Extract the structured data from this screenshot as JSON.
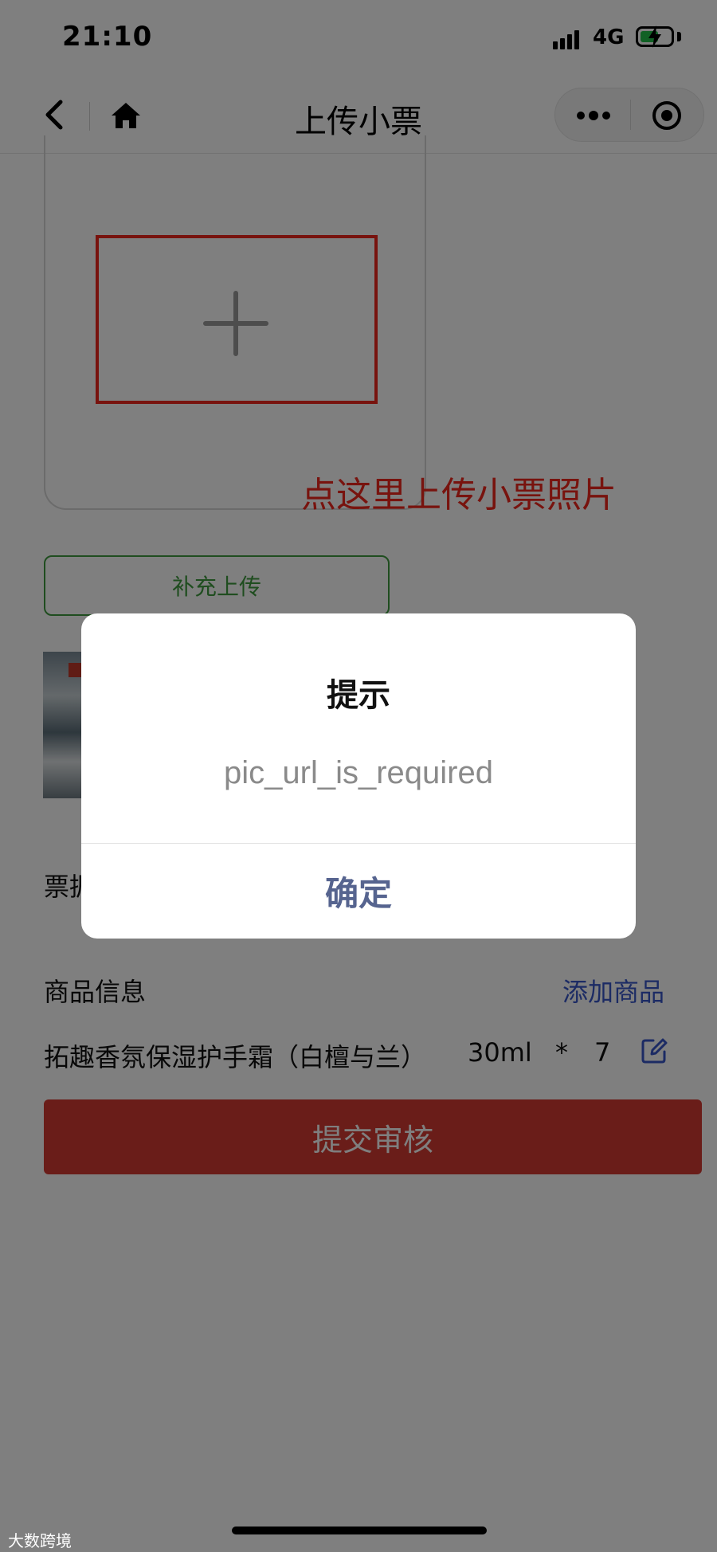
{
  "status_bar": {
    "time": "21:10",
    "network": "4G",
    "icons": [
      "signal-icon",
      "battery-charging-icon"
    ]
  },
  "nav_bar": {
    "title": "上传小票",
    "icons": [
      "back-icon",
      "home-icon",
      "more-icon",
      "close-miniprogram-icon"
    ]
  },
  "upload": {
    "annotation": "点这里上传小票照片",
    "supplement_button": "补充上传",
    "annotation_color": "#f0271c"
  },
  "form": {
    "ticket_label": "票据",
    "goods_section_label": "商品信息",
    "add_goods_link": "添加商品",
    "goods": [
      {
        "name": "拓趣香氛保湿护手霜（白檀与兰）",
        "size": "30ml",
        "multiplier": "*",
        "qty": "7"
      }
    ],
    "submit_button": "提交审核",
    "submit_color": "#d43a32"
  },
  "dialog": {
    "title": "提示",
    "message": "pic_url_is_required",
    "confirm_button": "确定"
  },
  "watermark": "大数跨境"
}
